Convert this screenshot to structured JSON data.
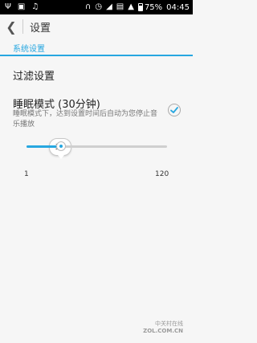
{
  "status_bar": {
    "battery": "75%",
    "time": "04:45",
    "battery_level": 0.75
  },
  "header": {
    "title": "设置"
  },
  "section": {
    "title": "系统设置"
  },
  "items": [
    {
      "title": "过滤设置"
    },
    {
      "title": "睡眠模式 (30分钟)",
      "description": "睡眠模式下，达到设置时间后自动为您停止音乐播放",
      "checked": true
    }
  ],
  "slider": {
    "value": 30,
    "min_label": "1",
    "max_label": "120",
    "min": 1,
    "max": 120
  },
  "watermark": {
    "line1": "中关村在线",
    "line2": "ZOL.COM.CN"
  },
  "colors": {
    "accent": "#27a7e0"
  }
}
